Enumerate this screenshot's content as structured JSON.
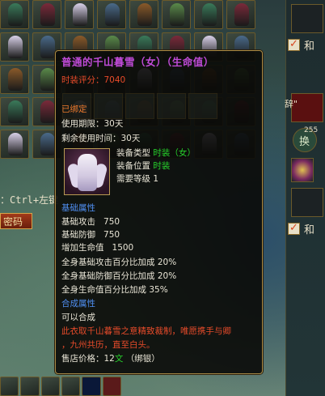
{
  "tooltip": {
    "title": "普通的千山暮雪（女）（生命值）",
    "score_label": "时装评分：",
    "score_value": "7040",
    "bound": "已绑定",
    "duration_label": "使用期限：",
    "duration_value": "30天",
    "remaining_label": "剩余使用时间：",
    "remaining_value": "30天",
    "equip_type_label": "装备类型",
    "equip_type_value": "时装（女）",
    "equip_pos_label": "装备位置",
    "equip_pos_value": "时装",
    "level_label": "需要等级",
    "level_value": "1",
    "base_header": "基础属性",
    "base_attack_label": "基础攻击",
    "base_attack_value": "750",
    "base_defense_label": "基础防御",
    "base_defense_value": "750",
    "hp_bonus_label": "增加生命值",
    "hp_bonus_value": "1500",
    "pct_attack": "全身基础攻击百分比加成",
    "pct_attack_value": "20%",
    "pct_defense": "全身基础防御百分比加成",
    "pct_defense_value": "20%",
    "pct_hp": "全身生命值百分比加成",
    "pct_hp_value": "35%",
    "compose_header": "合成属性",
    "compose_value": "可以合成",
    "desc_line1": "此衣取千山暮雪之意精致裁制，唯愿携手与卿",
    "desc_line2": "，九州共历，直至白头。",
    "price_label": "售店价格：",
    "price_value": "12",
    "price_unit": "文",
    "price_note": "（绑银）"
  },
  "background": {
    "ctrl_hint": "：Ctrl+左键",
    "password_button": "密码",
    "side_text_top": "和",
    "side_text_bottom": "和",
    "side_quote": "辞\"",
    "side_num": "255",
    "side_round_label": "换"
  },
  "colors": {
    "title": "#c04bd8",
    "accent_red": "#e84b2a",
    "accent_green": "#27d52c",
    "accent_blue": "#4f8ff2",
    "border_gold": "#a98a45"
  }
}
